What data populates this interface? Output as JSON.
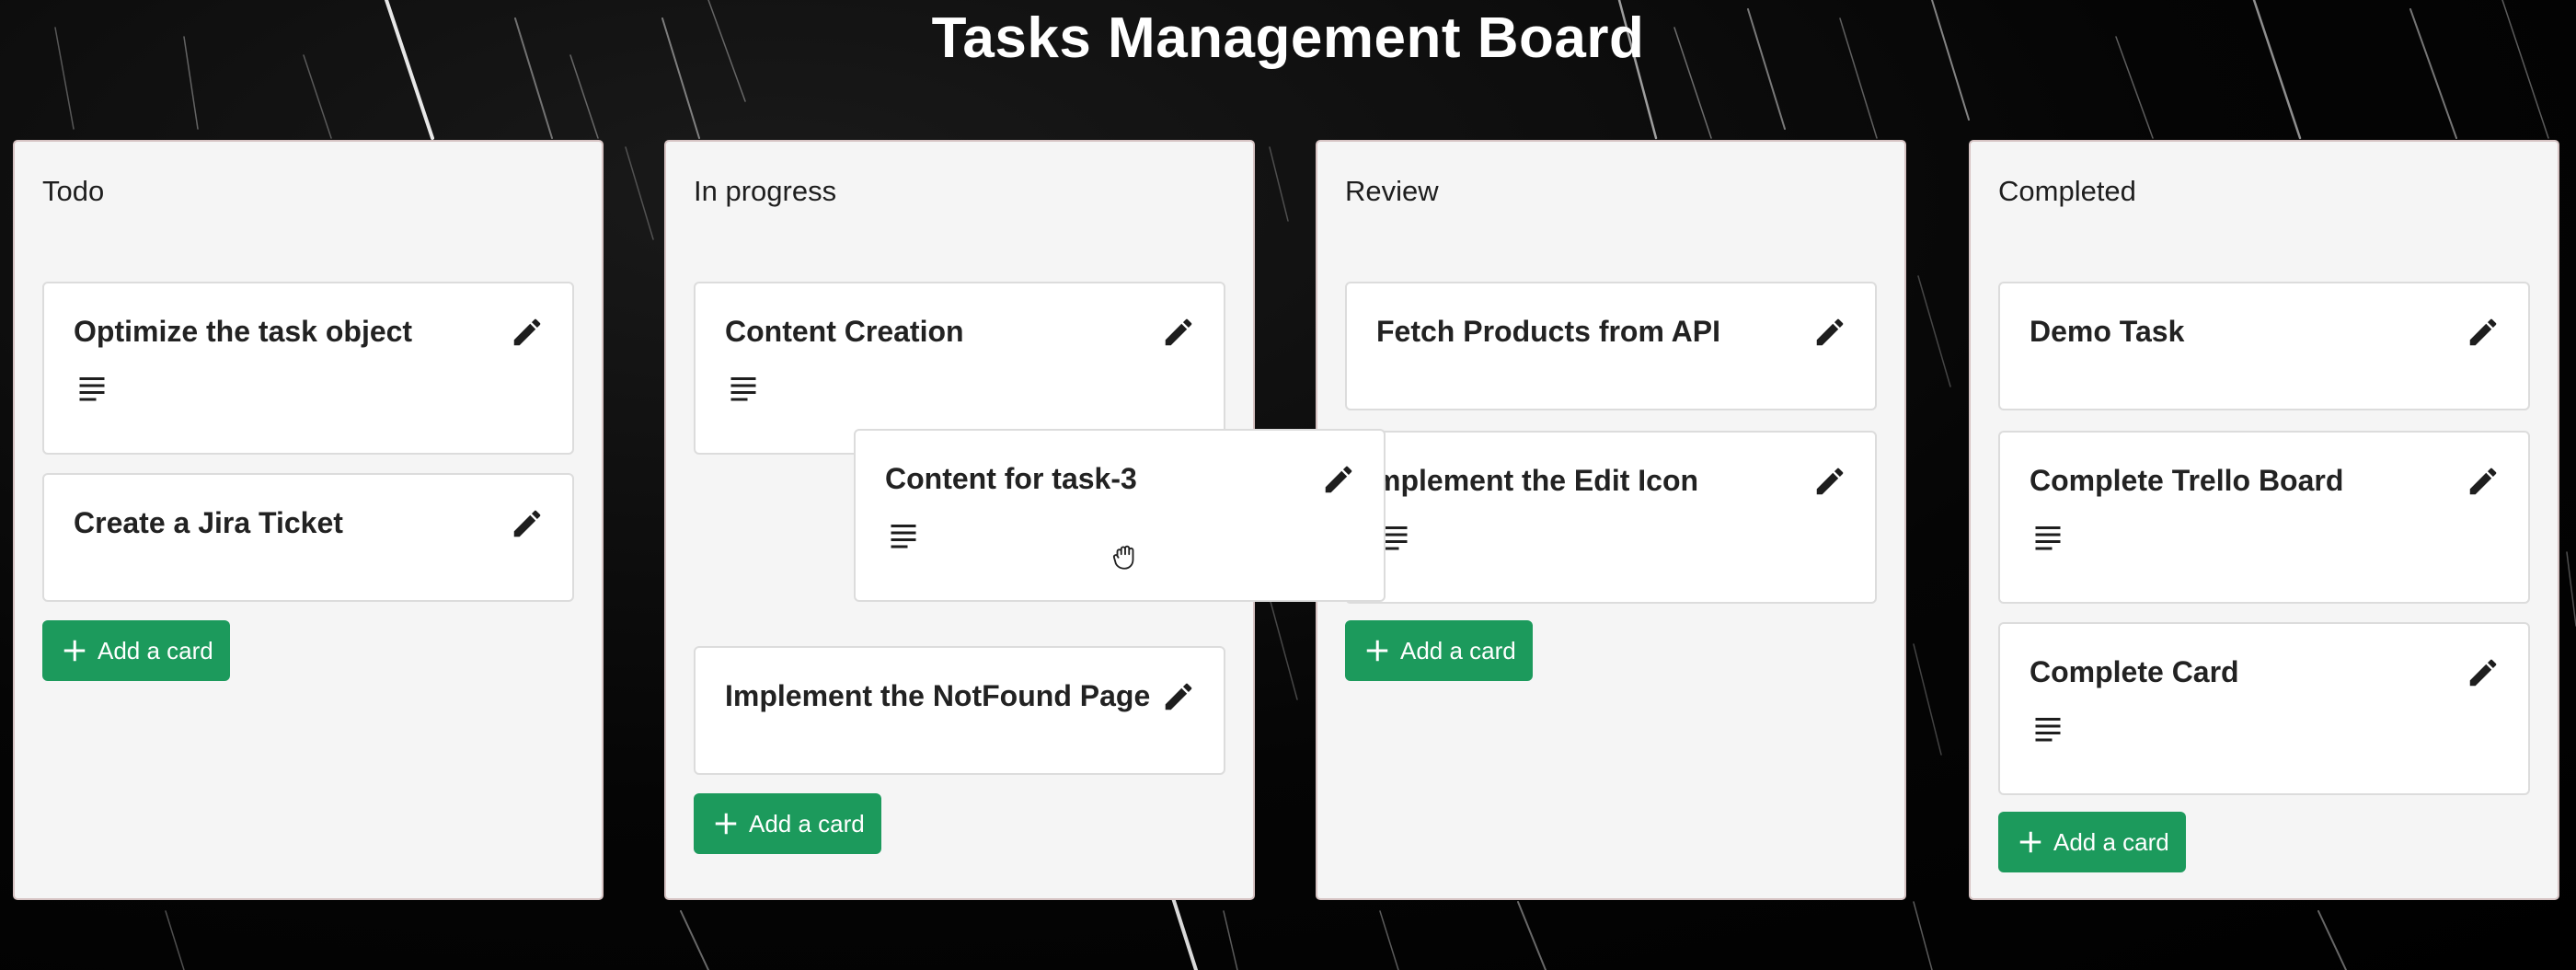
{
  "board": {
    "title": "Tasks Management Board"
  },
  "columns": [
    {
      "title": "Todo",
      "cards": [
        {
          "title": "Optimize the task object",
          "has_description": true
        },
        {
          "title": "Create a Jira Ticket",
          "has_description": false
        }
      ],
      "add_label": "Add a card"
    },
    {
      "title": "In progress",
      "cards": [
        {
          "title": "Content Creation",
          "has_description": true
        },
        {
          "title": "Implement the NotFound Page",
          "has_description": false
        }
      ],
      "add_label": "Add a card"
    },
    {
      "title": "Review",
      "cards": [
        {
          "title": "Fetch Products from API",
          "has_description": false
        },
        {
          "title": "mplement the Edit Icon",
          "has_description": true
        }
      ],
      "add_label": "Add a card"
    },
    {
      "title": "Completed",
      "cards": [
        {
          "title": "Demo Task",
          "has_description": false
        },
        {
          "title": "Complete Trello Board",
          "has_description": true
        },
        {
          "title": "Complete Card",
          "has_description": true
        }
      ],
      "add_label": "Add a card"
    }
  ],
  "dragging_card": {
    "title": "Content for task-3",
    "has_description": true
  },
  "colors": {
    "add_button": "#1c9a5c",
    "column_bg": "#f5f5f5",
    "card_bg": "#ffffff",
    "title_text": "#ffffff"
  },
  "icons": {
    "edit": "pencil-icon",
    "description": "lines-icon",
    "add": "plus-icon",
    "cursor": "grab-hand-icon"
  }
}
